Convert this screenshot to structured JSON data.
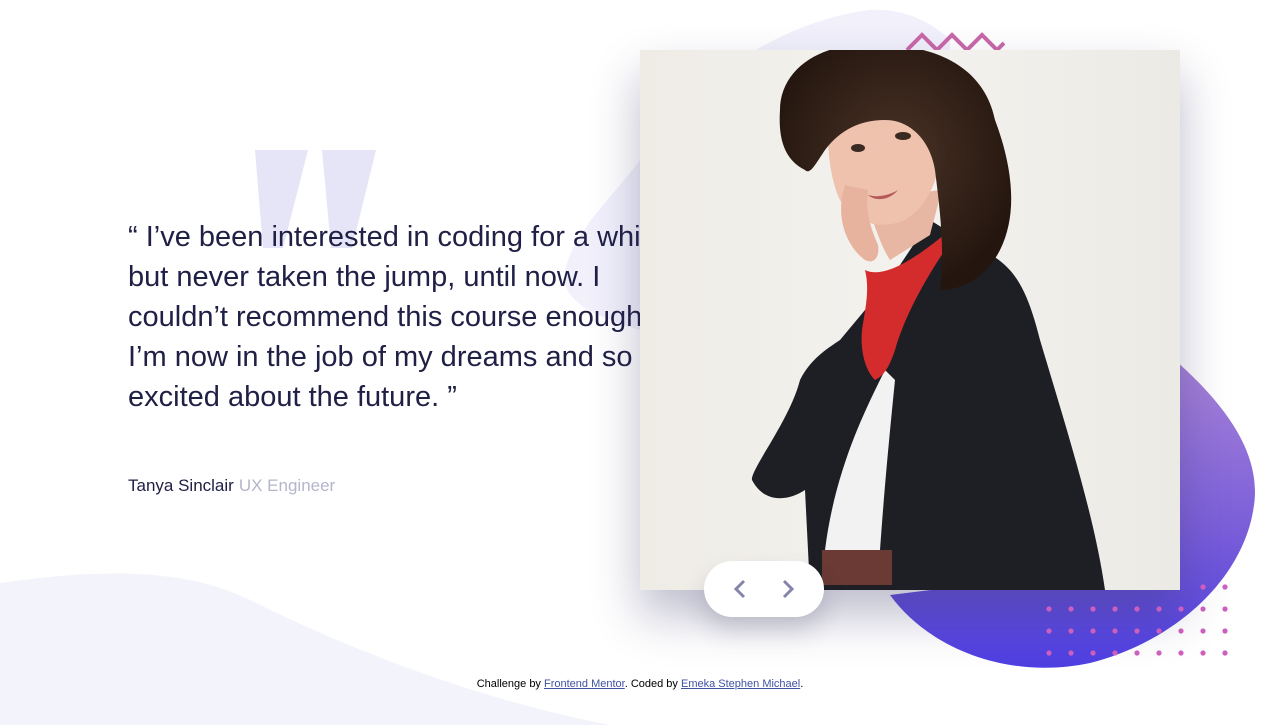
{
  "testimonial": {
    "quote": "“ I’ve been interested in coding for a while but never taken the jump, until now. I couldn’t recommend this course enough. I’m now in the job of my dreams and so excited about the future. ”",
    "author_name": "Tanya Sinclair",
    "author_role": "UX Engineer"
  },
  "slider": {
    "prev_icon": "chevron-left-icon",
    "next_icon": "chevron-right-icon"
  },
  "footer": {
    "prefix": "Challenge by",
    "challenge_link": "Frontend Mentor",
    "middle": ". Coded by",
    "author_link": "Emeka Stephen Michael",
    "suffix": "."
  },
  "colors": {
    "text_dark": "#202046",
    "text_muted": "#b5b5cc",
    "accent_purple": "#5a45e0",
    "accent_pink": "#d65ba8",
    "quote_mark": "#e6e4f7",
    "background_tint": "#f3f3fb",
    "link": "#3e52a3"
  }
}
